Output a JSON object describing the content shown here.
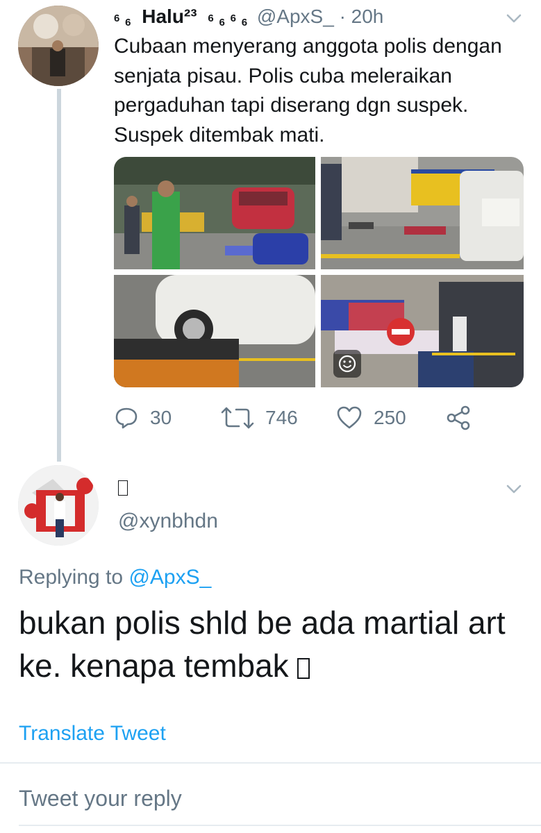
{
  "tweet": {
    "author_name": "Halu²³",
    "handle": "@ApxS_",
    "time": "· 20h",
    "name_decoration": "6",
    "text": "Cubaan menyerang anggota polis dengan senjata pisau. Polis cuba meleraikan pergaduhan tapi diserang dgn suspek. Suspek ditembak mati.",
    "media_count": 4,
    "actions": {
      "replies": "30",
      "retweets": "746",
      "likes": "250"
    }
  },
  "reply": {
    "author_name": "",
    "handle": "@xynbhdn",
    "replying_label": "Replying to",
    "replying_to": "@ApxS_",
    "text": "bukan polis shld be ada martial art ke. kenapa tembak",
    "translate_label": "Translate Tweet"
  },
  "compose": {
    "placeholder": "Tweet your reply"
  },
  "colors": {
    "accent": "#1da1f2",
    "secondary_text": "#657786",
    "thread_line": "#ccd6dd"
  }
}
